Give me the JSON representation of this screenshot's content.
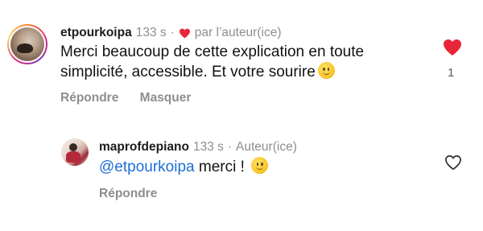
{
  "comments": [
    {
      "username": "etpourkoipa",
      "time": "133 s",
      "dot": "·",
      "author_like_label": "par l’auteur(ice)",
      "text": "Merci beaucoup de cette explication en toute simplicité, accessible. Et votre sourire",
      "emoji": "slightly-smiling-face",
      "reply_label": "Répondre",
      "hide_label": "Masquer",
      "likes": "1",
      "liked": true,
      "colors": {
        "heart": "#e8263a"
      }
    },
    {
      "username": "maprofdepiano",
      "time": "133 s",
      "dot": "·",
      "author_badge": "Auteur(ice)",
      "mention": "@etpourkoipa",
      "text": "merci !",
      "emoji": "slightly-smiling-face",
      "reply_label": "Répondre",
      "liked": false
    }
  ],
  "colors": {
    "mention": "#1d6fd6",
    "meta": "#8e8e8e"
  }
}
